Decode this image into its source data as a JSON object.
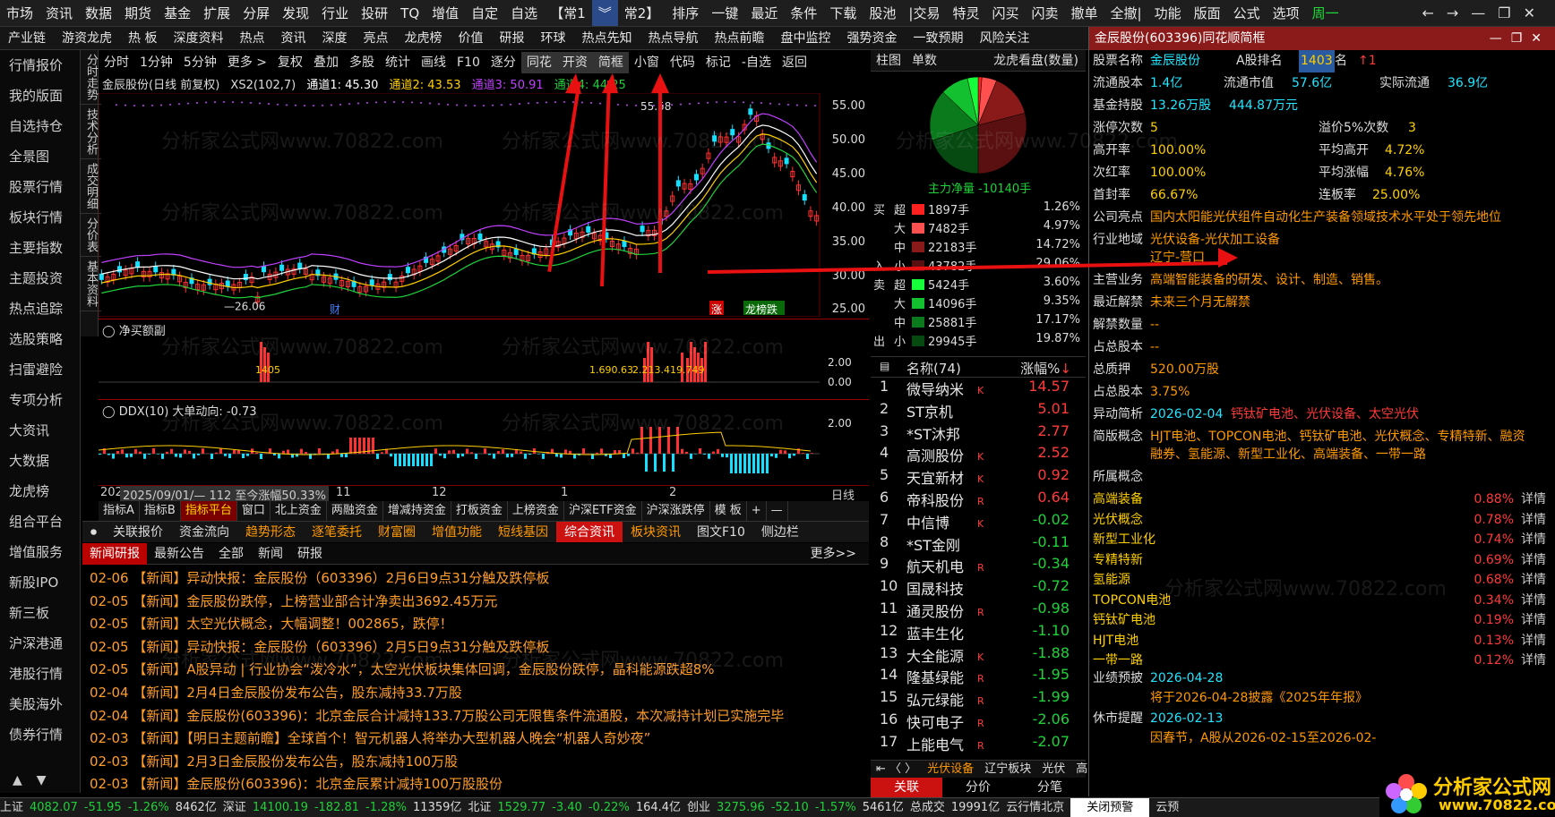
{
  "menubar": [
    "市场",
    "资讯",
    "数据",
    "期货",
    "基金",
    "扩展",
    "分屏",
    "发现",
    "行业",
    "投研",
    "TQ",
    "增值",
    "自定",
    "自选",
    "【常1",
    "︾",
    "常2】",
    "排序",
    "一键",
    "最近",
    "条件",
    "下载",
    "股池",
    "|交易",
    "特灵",
    "闪买",
    "闪卖",
    "撤单",
    "全撤|",
    "功能",
    "版面",
    "公式",
    "选项",
    "周一"
  ],
  "window_controls": [
    "←",
    "→",
    "—",
    "❐",
    "✕"
  ],
  "toolbar2": [
    "产业链",
    "游资龙虎",
    "热 板",
    "深度资料",
    "热点",
    "资讯",
    "深度",
    "亮点",
    "龙虎榜",
    "价值",
    "研报",
    "环球",
    "热点先知",
    "热点导航",
    "热点前瞻",
    "盘中监控",
    "强势资金",
    "一致预期",
    "风险关注"
  ],
  "leftnav": [
    "行情报价",
    "我的版面",
    "自选持仓",
    "全景图",
    "股票行情",
    "板块行情",
    "主要指数",
    "主题投资",
    "热点追踪",
    "选股策略",
    "扫雷避险",
    "专项分析",
    "大资讯",
    "大数据",
    "龙虎榜",
    "组合平台",
    "增值服务",
    "新股IPO",
    "新三板",
    "沪深港通",
    "港股行情",
    "美股海外",
    "债券行情"
  ],
  "vtabs": [
    "分时走势",
    "技术分析",
    "成交明细",
    "分价表",
    "基本资料"
  ],
  "chart_toolbar": [
    "分时",
    "1分钟",
    "5分钟",
    "更多 >",
    "复权",
    "叠加",
    "多股",
    "统计",
    "画线",
    "F10",
    "逐分",
    "同花",
    "开资",
    "简框",
    "小窗",
    "代码",
    "标记",
    "-自选",
    "返回"
  ],
  "chart_info": {
    "title": "金辰股份(日线 前复权)",
    "xs2": "XS2(102,7)",
    "ch1": "通道1: 45.30",
    "ch2": "通道2: 43.53",
    "ch3": "通道3: 50.91",
    "ch4": "通道4: 44.25"
  },
  "chart_data": {
    "type": "candlestick",
    "ylim": [
      24,
      57
    ],
    "yticks": [
      "55.00",
      "50.00",
      "45.00",
      "40.00",
      "35.00",
      "30.00",
      "25.00"
    ],
    "high_label": "55.58",
    "low_label": "26.06",
    "markers": [
      "财",
      "涨",
      "龙",
      "榜",
      "跌"
    ],
    "sub1_label": "净买额副",
    "sub1_yticks": [
      "2.00",
      "0.00"
    ],
    "sub1_values": [
      "1405",
      "1.690.63",
      "2.21",
      "3.41",
      "9.7",
      "49"
    ],
    "sub2_label": "DDX(10) 大单动向: -0.73",
    "sub2_ytick": "2.00",
    "date_axis": [
      "2025/09/01/— 112 至今涨幅50.33%",
      "11",
      "12",
      "1",
      "2"
    ],
    "date_prefix": "202",
    "period": "日线"
  },
  "bottom_tabs": [
    "指标A",
    "指标B",
    "指标平台",
    "窗口",
    "北上资金",
    "两融资金",
    "增减持资金",
    "打板资金",
    "上榜资金",
    "沪深ETF资金",
    "沪深涨跌停",
    "模 板",
    "+",
    "—"
  ],
  "news_tabs": [
    "关联报价",
    "资金流向",
    "趋势形态",
    "逐笔委托",
    "财富圈",
    "增值功能",
    "短线基因",
    "综合资讯",
    "板块资讯",
    "图文F10",
    "侧边栏"
  ],
  "news_sub": [
    "新闻研报",
    "最新公告",
    "全部",
    "新闻",
    "研报",
    "更多>>"
  ],
  "news": [
    "02-06 【新闻】异动快报：金辰股份（603396）2月6日9点31分触及跌停板",
    "02-05 【新闻】金辰股份跌停，上榜营业部合计净卖出3692.45万元",
    "02-05 【新闻】太空光伏概念，大幅调整！002865，跌停！",
    "02-05 【新闻】异动快报：金辰股份（603396）2月5日9点31分触及跌停板",
    "02-05 【新闻】A股异动 | 行业协会“泼冷水”，太空光伏板块集体回调，金辰股份跌停，晶科能源跌超8%",
    "02-04 【新闻】2月4日金辰股份发布公告，股东减持33.7万股",
    "02-04 【新闻】金辰股份(603396)：北京金辰合计减持133.7万股公司无限售条件流通股，本次减持计划已实施完毕",
    "02-03 【新闻】【明日主题前瞻】全球首个！智元机器人将举办大型机器人晚会“机器人奇妙夜”",
    "02-03 【新闻】2月3日金辰股份发布公告，股东减持100万股",
    "02-03 【新闻】金辰股份(603396)：北京金辰累计减持100万股股份"
  ],
  "pie_tabs": [
    "柱图",
    "单数",
    "龙虎看盘(数量)"
  ],
  "pie": {
    "label": "主力净量 -10140手"
  },
  "flow": [
    {
      "side": "买",
      "sz": "超",
      "color": "#ff2020",
      "v": "1897手",
      "p": "1.26%"
    },
    {
      "side": "",
      "sz": "大",
      "color": "#ff5050",
      "v": "7482手",
      "p": "4.97%"
    },
    {
      "side": "",
      "sz": "中",
      "color": "#8a1a1a",
      "v": "22183手",
      "p": "14.72%"
    },
    {
      "side": "入",
      "sz": "小",
      "color": "#5a1010",
      "v": "43782手",
      "p": "29.06%"
    },
    {
      "side": "卖",
      "sz": "超",
      "color": "#16ff3a",
      "v": "5424手",
      "p": "3.60%"
    },
    {
      "side": "",
      "sz": "大",
      "color": "#12c030",
      "v": "14096手",
      "p": "9.35%"
    },
    {
      "side": "",
      "sz": "中",
      "color": "#0a7a1c",
      "v": "25881手",
      "p": "17.17%"
    },
    {
      "side": "出",
      "sz": "小",
      "color": "#064a12",
      "v": "29945手",
      "p": "19.87%"
    }
  ],
  "rank_header": {
    "name": "名称(74)",
    "chg": "涨幅%"
  },
  "ranks": [
    {
      "n": "1",
      "name": "微导纳米",
      "tag": "K",
      "pc": "14.57",
      "c": "#ff3a3a"
    },
    {
      "n": "2",
      "name": "ST京机",
      "tag": "",
      "pc": "5.01",
      "c": "#ff3a3a"
    },
    {
      "n": "3",
      "name": "*ST沐邦",
      "tag": "",
      "pc": "2.77",
      "c": "#ff3a3a"
    },
    {
      "n": "4",
      "name": "高测股份",
      "tag": "K",
      "pc": "2.52",
      "c": "#ff3a3a"
    },
    {
      "n": "5",
      "name": "天宜新材",
      "tag": "K",
      "pc": "0.92",
      "c": "#ff3a3a"
    },
    {
      "n": "6",
      "name": "帝科股份",
      "tag": "R",
      "pc": "0.64",
      "c": "#ff3a3a"
    },
    {
      "n": "7",
      "name": "中信博",
      "tag": "K",
      "pc": "-0.02",
      "c": "#1fd23a"
    },
    {
      "n": "8",
      "name": "*ST金刚",
      "tag": "",
      "pc": "-0.11",
      "c": "#1fd23a"
    },
    {
      "n": "9",
      "name": "航天机电",
      "tag": "R",
      "pc": "-0.34",
      "c": "#1fd23a"
    },
    {
      "n": "10",
      "name": "国晟科技",
      "tag": "",
      "pc": "-0.72",
      "c": "#1fd23a"
    },
    {
      "n": "11",
      "name": "通灵股份",
      "tag": "R",
      "pc": "-0.98",
      "c": "#1fd23a"
    },
    {
      "n": "12",
      "name": "蓝丰生化",
      "tag": "",
      "pc": "-1.10",
      "c": "#1fd23a"
    },
    {
      "n": "13",
      "name": "大全能源",
      "tag": "K",
      "pc": "-1.88",
      "c": "#1fd23a"
    },
    {
      "n": "14",
      "name": "隆基绿能",
      "tag": "R",
      "pc": "-1.95",
      "c": "#1fd23a"
    },
    {
      "n": "15",
      "name": "弘元绿能",
      "tag": "R",
      "pc": "-1.99",
      "c": "#1fd23a"
    },
    {
      "n": "16",
      "name": "快可电子",
      "tag": "R",
      "pc": "-2.06",
      "c": "#1fd23a"
    },
    {
      "n": "17",
      "name": "上能电气",
      "tag": "R",
      "pc": "-2.07",
      "c": "#1fd23a"
    }
  ],
  "rank_foot": [
    "光伏设备",
    "辽宁板块",
    "光伏",
    "高"
  ],
  "rank_foot2": [
    "关联",
    "分价",
    "分笔"
  ],
  "rp": {
    "title": "金辰股份(603396)同花顺简框",
    "ctl": "—❐✕",
    "r1": {
      "a": "股票名称",
      "b": "金辰股份",
      "c": "A股排名",
      "d": "1403",
      "e": "名",
      "f": "↑1"
    },
    "r2": {
      "a": "流通股本",
      "b": "1.4亿",
      "c": "流通市值",
      "d": "57.6亿",
      "e": "实际流通",
      "f": "36.9亿"
    },
    "r3": {
      "a": "基金持股",
      "b": "13.26万股",
      "c": "444.87万元"
    },
    "r4": {
      "a": "涨停次数",
      "b": "5",
      "c": "溢价5%次数",
      "d": "3"
    },
    "r5": {
      "a": "高开率",
      "b": "100.00%",
      "c": "平均高开",
      "d": "4.72%"
    },
    "r6": {
      "a": "次红率",
      "b": "100.00%",
      "c": "平均涨幅",
      "d": "4.76%"
    },
    "r7": {
      "a": "首封率",
      "b": "66.67%",
      "c": "连板率",
      "d": "25.00%"
    },
    "r8": {
      "a": "公司亮点",
      "b": "国内太阳能光伏组件自动化生产装备领域技术水平处于领先地位"
    },
    "r9": {
      "a": "行业地域",
      "b": "光伏设备-光伏加工设备",
      "c": "辽宁-营口"
    },
    "r10": {
      "a": "主营业务",
      "b": "高端智能装备的研发、设计、制造、销售。"
    },
    "r11": {
      "a": "最近解禁",
      "b": "未来三个月无解禁"
    },
    "r12": {
      "a": "解禁数量",
      "b": "--"
    },
    "r13": {
      "a": "占总股本",
      "b": "--"
    },
    "r14": {
      "a": "总质押",
      "b": "520.00万股"
    },
    "r15": {
      "a": "占总股本",
      "b": "3.75%"
    },
    "r16": {
      "a": "异动简析",
      "b": "2026-02-04",
      "c": "钙钛矿电池、光伏设备、太空光伏"
    },
    "r17": {
      "a": "简版概念",
      "b": "HJT电池、TOPCON电池、钙钛矿电池、光伏概念、专精特新、融资",
      "c": "融券、氢能源、新型工业化、高端装备、一带一路"
    },
    "r18": {
      "a": "所属概念"
    },
    "concepts": [
      {
        "n": "高端装备",
        "p": "0.88%",
        "d": "详情"
      },
      {
        "n": "光伏概念",
        "p": "0.78%",
        "d": "详情"
      },
      {
        "n": "新型工业化",
        "p": "0.74%",
        "d": "详情"
      },
      {
        "n": "专精特新",
        "p": "0.69%",
        "d": "详情"
      },
      {
        "n": "氢能源",
        "p": "0.68%",
        "d": "详情"
      },
      {
        "n": "TOPCON电池",
        "p": "0.34%",
        "d": "详情"
      },
      {
        "n": "钙钛矿电池",
        "p": "0.19%",
        "d": "详情"
      },
      {
        "n": "HJT电池",
        "p": "0.13%",
        "d": "详情"
      },
      {
        "n": "一带一路",
        "p": "0.12%",
        "d": "详情"
      }
    ],
    "r19": {
      "a": "业绩预披",
      "b": "2026-04-28",
      "c": "将于2026-04-28披露《2025年年报》"
    },
    "r20": {
      "a": "休市提醒",
      "b": "2026-02-13",
      "c": "因春节，A股从2026-02-15至2026-02-"
    }
  },
  "status": {
    "sh_label": "上证",
    "sh": "4082.07",
    "sh_c": "-51.95",
    "sh_p": "-1.26%",
    "sh_v": "8462亿",
    "sz_label": "深证",
    "sz": "14100.19",
    "sz_c": "-182.81",
    "sz_p": "-1.28%",
    "sz_v": "11359亿",
    "bz_label": "北证",
    "bz": "1529.77",
    "bz_c": "-3.40",
    "bz_p": "-0.22%",
    "bz_v": "164.4亿",
    "cy_label": "创业",
    "cy": "3275.96",
    "cy_c": "-52.10",
    "cy_p": "-1.57%",
    "cy_v": "5461亿",
    "extra": "总成交",
    "extra2": "19991亿",
    "cloud": "云行情北京",
    "close_alert": "关闭预警",
    "cloud2": "云预"
  },
  "logo": {
    "text": "分析家公式网",
    "url": "www.70822.com"
  },
  "watermark": "分析家公式网www.70822.com"
}
